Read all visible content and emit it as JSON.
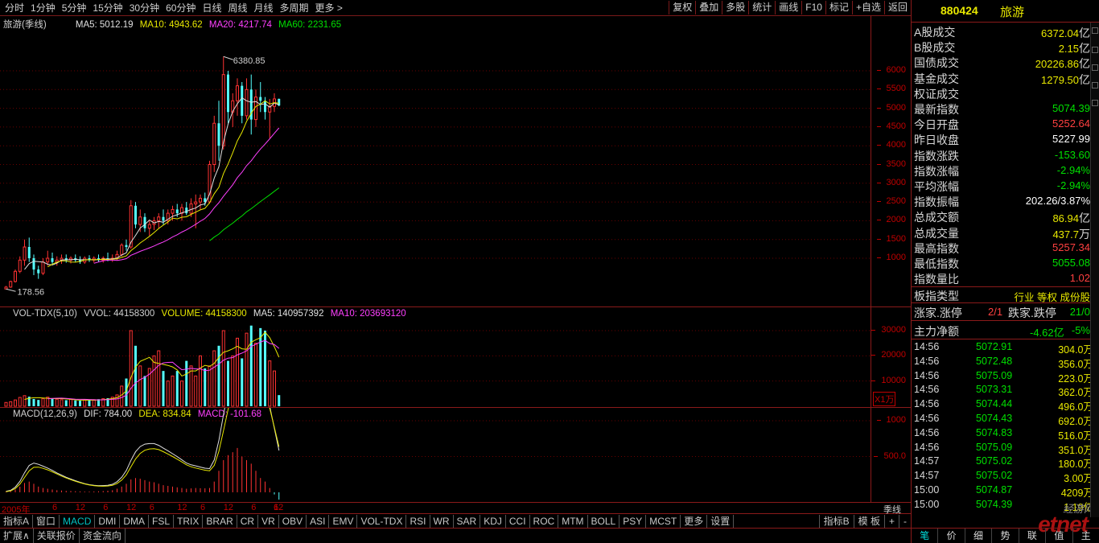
{
  "toolbar": {
    "periods": [
      "分时",
      "1分钟",
      "5分钟",
      "15分钟",
      "30分钟",
      "60分钟",
      "日线",
      "周线",
      "月线",
      "多周期",
      "更多 >"
    ],
    "tools": [
      "复权",
      "叠加",
      "多股",
      "统计",
      "画线",
      "F10",
      "标记",
      "+自选",
      "返回"
    ]
  },
  "main_pane": {
    "title": "旅游(季线)",
    "ma5": "MA5: 5012.19",
    "ma10": "MA10: 4943.62",
    "ma20": "MA20: 4217.74",
    "ma60": "MA60: 2231.65",
    "high_label": "6380.85",
    "low_label": "178.56",
    "y_ticks": [
      "6000",
      "5500",
      "5000",
      "4500",
      "4000",
      "3500",
      "3000",
      "2500",
      "2000",
      "1500",
      "1000"
    ]
  },
  "vol_pane": {
    "title": "VOL-TDX(5,10)",
    "vvol": "VVOL: 44158300",
    "volume": "VOLUME: 44158300",
    "ma5": "MA5: 140957392",
    "ma10": "MA10: 203693120",
    "y_ticks": [
      "30000",
      "20000",
      "10000"
    ],
    "unit": "X1万"
  },
  "macd_pane": {
    "title": "MACD(12,26,9)",
    "dif": "DIF: 784.00",
    "dea": "DEA: 834.84",
    "macd": "MACD: -101.68",
    "y_ticks": [
      "1000",
      "500.0"
    ]
  },
  "x_axis": {
    "labels": [
      "2005年",
      "6",
      "12",
      "6",
      "12",
      "6",
      "12",
      "6",
      "12",
      "6",
      "12",
      "6"
    ],
    "period": "季线"
  },
  "indicator_tabs": [
    "指标A",
    "窗口",
    "MACD",
    "DMI",
    "DMA",
    "FSL",
    "TRIX",
    "BRAR",
    "CR",
    "VR",
    "OBV",
    "ASI",
    "EMV",
    "VOL-TDX",
    "RSI",
    "WR",
    "SAR",
    "KDJ",
    "CCI",
    "ROC",
    "MTM",
    "BOLL",
    "PSY",
    "MCST",
    "更多",
    "设置"
  ],
  "indicator_active": "MACD",
  "indicator_right": [
    "指标B",
    "模 板",
    "+",
    "-"
  ],
  "bottom_tabs": [
    "扩展∧",
    "关联报价",
    "资金流向"
  ],
  "side": {
    "code": "880424",
    "name": "旅游",
    "stats_top": [
      {
        "label": "A股成交",
        "value": "6372.04",
        "unit": "亿",
        "color": "#e8e800"
      },
      {
        "label": "B股成交",
        "value": "2.15",
        "unit": "亿",
        "color": "#e8e800"
      },
      {
        "label": "国债成交",
        "value": "20226.86",
        "unit": "亿",
        "color": "#e8e800"
      },
      {
        "label": "基金成交",
        "value": "1279.50",
        "unit": "亿",
        "color": "#e8e800"
      },
      {
        "label": "权证成交",
        "value": "",
        "unit": "",
        "color": "#e8e800"
      }
    ],
    "stats_mid": [
      {
        "label": "最新指数",
        "value": "5074.39",
        "unit": "",
        "color": "#00e000"
      },
      {
        "label": "今日开盘",
        "value": "5252.64",
        "unit": "",
        "color": "#ff4040"
      },
      {
        "label": "昨日收盘",
        "value": "5227.99",
        "unit": "",
        "color": "#ffffff"
      },
      {
        "label": "指数涨跌",
        "value": "-153.60",
        "unit": "",
        "color": "#00e000"
      },
      {
        "label": "指数涨幅",
        "value": "-2.94%",
        "unit": "",
        "color": "#00e000"
      },
      {
        "label": "平均涨幅",
        "value": "-2.94%",
        "unit": "",
        "color": "#00e000"
      },
      {
        "label": "指数振幅",
        "value": "202.26/3.87%",
        "unit": "",
        "color": "#ffffff"
      },
      {
        "label": "总成交额",
        "value": "86.94",
        "unit": "亿",
        "color": "#e8e800"
      },
      {
        "label": "总成交量",
        "value": "437.7",
        "unit": "万",
        "color": "#e8e800"
      },
      {
        "label": "最高指数",
        "value": "5257.34",
        "unit": "",
        "color": "#ff4040"
      },
      {
        "label": "最低指数",
        "value": "5055.08",
        "unit": "",
        "color": "#00e000"
      },
      {
        "label": "指数量比",
        "value": "1.02",
        "unit": "",
        "color": "#ff4040"
      }
    ],
    "board_type_label": "板指类型",
    "board_type_value": "行业 等权 成份股",
    "up_label": "涨家.涨停",
    "up_value": "2/1",
    "down_label": "跌家.跌停",
    "down_value": "21/0",
    "net_label": "主力净额",
    "net_value": "-4.62亿",
    "net_pct": "-5%",
    "ticks": [
      {
        "time": "14:56",
        "price": "5072.91",
        "vol": "304.0万"
      },
      {
        "time": "14:56",
        "price": "5072.48",
        "vol": "356.0万"
      },
      {
        "time": "14:56",
        "price": "5075.09",
        "vol": "223.0万"
      },
      {
        "time": "14:56",
        "price": "5073.31",
        "vol": "362.0万"
      },
      {
        "time": "14:56",
        "price": "5074.44",
        "vol": "496.0万"
      },
      {
        "time": "14:56",
        "price": "5074.43",
        "vol": "692.0万"
      },
      {
        "time": "14:56",
        "price": "5074.83",
        "vol": "516.0万"
      },
      {
        "time": "14:56",
        "price": "5075.09",
        "vol": "351.0万"
      },
      {
        "time": "14:57",
        "price": "5075.02",
        "vol": "180.0万"
      },
      {
        "time": "14:57",
        "price": "5075.02",
        "vol": "3.00万"
      },
      {
        "time": "15:00",
        "price": "5074.87",
        "vol": "4209万"
      },
      {
        "time": "15:00",
        "price": "5074.39",
        "vol": "1.19亿"
      }
    ],
    "tabs": [
      "笔",
      "价",
      "细",
      "势",
      "联",
      "值",
      "主"
    ],
    "watermark": "经游网",
    "watermark_big": "etnet"
  },
  "chart_data": {
    "type": "candlestick",
    "period": "quarterly",
    "index_name": "旅游",
    "ylim": [
      0,
      6600
    ],
    "ohlc": [
      [
        180,
        260,
        179,
        230
      ],
      [
        230,
        400,
        210,
        380
      ],
      [
        380,
        700,
        350,
        650
      ],
      [
        650,
        1050,
        600,
        950
      ],
      [
        950,
        1500,
        800,
        1300
      ],
      [
        1300,
        1550,
        900,
        1000
      ],
      [
        1000,
        1100,
        550,
        700
      ],
      [
        700,
        800,
        450,
        600
      ],
      [
        600,
        1000,
        550,
        900
      ],
      [
        900,
        1200,
        800,
        1000
      ],
      [
        1000,
        1150,
        850,
        900
      ],
      [
        900,
        1050,
        800,
        950
      ],
      [
        950,
        1100,
        850,
        1000
      ],
      [
        1000,
        1100,
        880,
        950
      ],
      [
        950,
        1050,
        860,
        1000
      ],
      [
        1000,
        1100,
        900,
        950
      ],
      [
        950,
        1050,
        850,
        900
      ],
      [
        900,
        1050,
        850,
        1000
      ],
      [
        1000,
        1080,
        900,
        950
      ],
      [
        950,
        1050,
        880,
        1000
      ],
      [
        1000,
        1100,
        900,
        950
      ],
      [
        950,
        1050,
        880,
        1000
      ],
      [
        1000,
        1150,
        920,
        980
      ],
      [
        980,
        1100,
        900,
        1000
      ],
      [
        1000,
        1200,
        950,
        1100
      ],
      [
        1100,
        1400,
        1050,
        1350
      ],
      [
        1350,
        1500,
        1200,
        1300
      ],
      [
        1300,
        2550,
        1250,
        2400
      ],
      [
        2400,
        2500,
        1800,
        1900
      ],
      [
        1900,
        2300,
        1700,
        2100
      ],
      [
        2100,
        2200,
        1700,
        1800
      ],
      [
        1800,
        2000,
        1600,
        1900
      ],
      [
        1900,
        2100,
        1750,
        2000
      ],
      [
        2000,
        2200,
        1800,
        2100
      ],
      [
        2100,
        2300,
        1900,
        2000
      ],
      [
        2000,
        2300,
        1900,
        2200
      ],
      [
        2200,
        2400,
        2000,
        2300
      ],
      [
        2300,
        2450,
        2100,
        2200
      ],
      [
        2200,
        2450,
        2000,
        2350
      ],
      [
        2350,
        2500,
        2150,
        2200
      ],
      [
        2200,
        2600,
        2100,
        2450
      ],
      [
        2450,
        2700,
        1800,
        2500
      ],
      [
        2500,
        2700,
        2300,
        2600
      ],
      [
        2600,
        2750,
        2400,
        2500
      ],
      [
        2500,
        3600,
        2450,
        3500
      ],
      [
        3500,
        4800,
        3300,
        4600
      ],
      [
        4600,
        5200,
        3600,
        4000
      ],
      [
        4000,
        6381,
        3900,
        5900
      ],
      [
        5900,
        6000,
        4600,
        4900
      ],
      [
        4900,
        5400,
        4500,
        5200
      ],
      [
        5200,
        5800,
        4800,
        5600
      ],
      [
        5600,
        5700,
        4600,
        4800
      ],
      [
        4800,
        5800,
        4700,
        5500
      ],
      [
        5500,
        5900,
        4300,
        4700
      ],
      [
        4700,
        5500,
        4500,
        5300
      ],
      [
        5300,
        5700,
        4900,
        5200
      ],
      [
        5200,
        5300,
        4700,
        4900
      ],
      [
        4900,
        5250,
        4200,
        5050
      ],
      [
        5050,
        5400,
        4900,
        5250
      ],
      [
        5252,
        5257,
        5055,
        5074
      ]
    ],
    "volume_wan": [
      1500,
      1800,
      2500,
      3500,
      4200,
      3800,
      2900,
      2500,
      3000,
      3600,
      3200,
      2800,
      2600,
      2400,
      2700,
      2300,
      2200,
      2500,
      2400,
      2600,
      2800,
      3000,
      3200,
      3600,
      4500,
      8000,
      11000,
      30000,
      24000,
      16000,
      12000,
      15000,
      20000,
      22000,
      14000,
      10000,
      12000,
      14000,
      10000,
      18000,
      16000,
      12000,
      20000,
      15000,
      16000,
      22000,
      24000,
      30000,
      18000,
      20000,
      27000,
      19000,
      29000,
      32000,
      25000,
      31000,
      30000,
      18000,
      14000,
      4416
    ],
    "macd_hist": [
      10,
      15,
      40,
      80,
      130,
      150,
      120,
      80,
      60,
      50,
      40,
      30,
      25,
      20,
      18,
      15,
      12,
      10,
      10,
      12,
      14,
      18,
      22,
      30,
      50,
      80,
      120,
      180,
      200,
      190,
      170,
      150,
      140,
      120,
      100,
      90,
      80,
      70,
      60,
      50,
      55,
      60,
      58,
      56,
      60,
      150,
      300,
      450,
      520,
      560,
      620,
      500,
      450,
      400,
      300,
      200,
      150,
      60,
      -30,
      -102
    ]
  }
}
